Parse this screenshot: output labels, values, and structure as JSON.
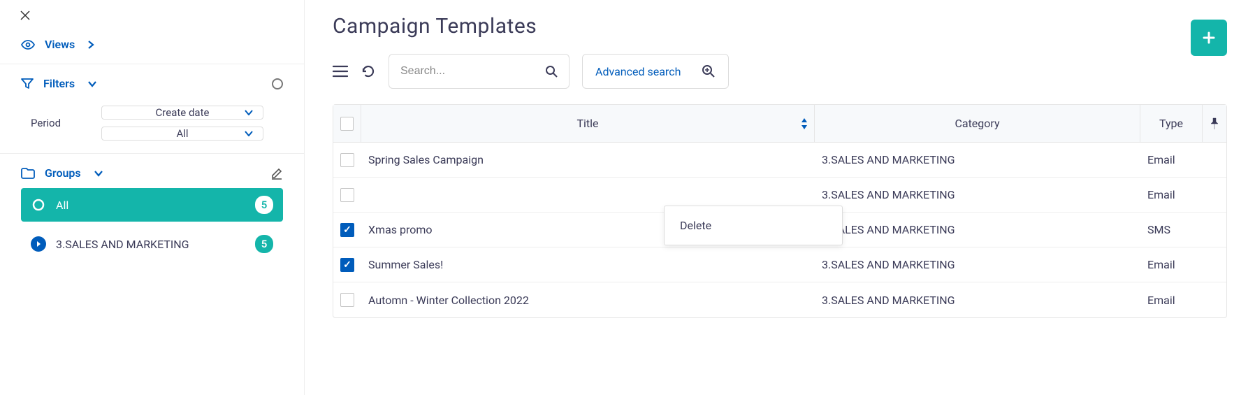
{
  "sidebar": {
    "views_label": "Views",
    "filters_label": "Filters",
    "period_label": "Period",
    "period_select1": "Create date",
    "period_select2": "All",
    "groups_label": "Groups",
    "groups": [
      {
        "label": "All",
        "count": "5",
        "active": true
      },
      {
        "label": "3.SALES AND MARKETING",
        "count": "5",
        "active": false
      }
    ]
  },
  "main": {
    "title": "Campaign Templates",
    "search_placeholder": "Search...",
    "advanced_search_label": "Advanced search",
    "columns": {
      "title": "Title",
      "category": "Category",
      "type": "Type"
    },
    "rows": [
      {
        "title": "Spring Sales Campaign",
        "category": "3.SALES AND MARKETING",
        "type": "Email",
        "checked": false
      },
      {
        "title": "",
        "category": "3.SALES AND MARKETING",
        "type": "Email",
        "checked": false
      },
      {
        "title": "Xmas promo",
        "category": "3.SALES AND MARKETING",
        "type": "SMS",
        "checked": true
      },
      {
        "title": "Summer Sales!",
        "category": "3.SALES AND MARKETING",
        "type": "Email",
        "checked": true
      },
      {
        "title": "Automn - Winter Collection 2022",
        "category": "3.SALES AND MARKETING",
        "type": "Email",
        "checked": false
      }
    ],
    "context_menu": {
      "delete": "Delete"
    }
  }
}
